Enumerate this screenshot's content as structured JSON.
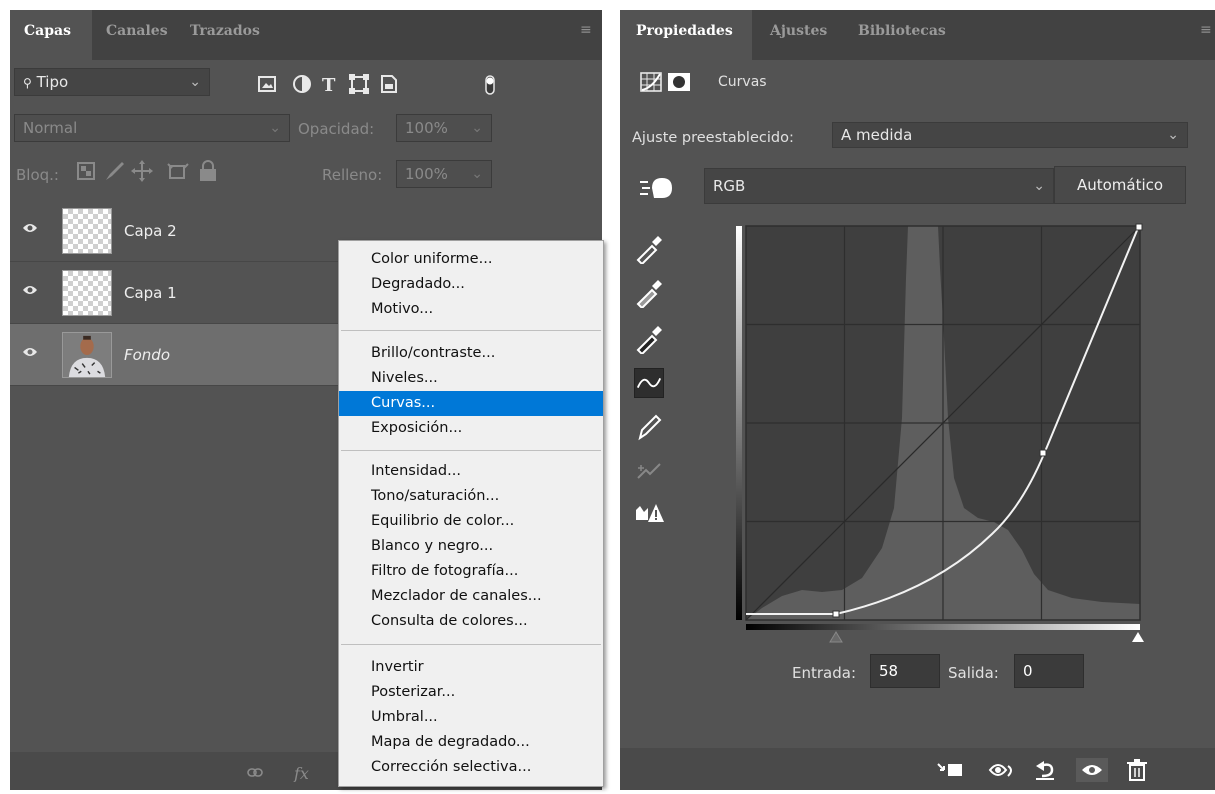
{
  "layers_panel": {
    "tabs": [
      {
        "label": "Capas",
        "active": true
      },
      {
        "label": "Canales",
        "active": false
      },
      {
        "label": "Trazados",
        "active": false
      }
    ],
    "filter": {
      "label": "Tipo",
      "icon": "search-icon"
    },
    "blend_mode": "Normal",
    "opacity": {
      "label": "Opacidad:",
      "value": "100%"
    },
    "lock_label": "Bloq.:",
    "fill": {
      "label": "Relleno:",
      "value": "100%"
    },
    "layers": [
      {
        "name": "Capa 2",
        "visible": true,
        "selected": false
      },
      {
        "name": "Capa 1",
        "visible": true,
        "selected": false
      },
      {
        "name": "Fondo",
        "visible": true,
        "selected": true
      }
    ]
  },
  "context_menu": {
    "groups": [
      [
        "Color uniforme...",
        "Degradado...",
        "Motivo..."
      ],
      [
        "Brillo/contraste...",
        "Niveles...",
        "Curvas...",
        "Exposición..."
      ],
      [
        "Intensidad...",
        "Tono/saturación...",
        "Equilibrio de color...",
        "Blanco y negro...",
        "Filtro de fotografía...",
        "Mezclador de canales...",
        "Consulta de colores..."
      ],
      [
        "Invertir",
        "Posterizar...",
        "Umbral...",
        "Mapa de degradado...",
        "Corrección selectiva..."
      ]
    ],
    "highlighted": "Curvas..."
  },
  "properties_panel": {
    "tabs": [
      {
        "label": "Propiedades",
        "active": true
      },
      {
        "label": "Ajustes",
        "active": false
      },
      {
        "label": "Bibliotecas",
        "active": false
      }
    ],
    "header_title": "Curvas",
    "preset": {
      "label": "Ajuste preestablecido:",
      "value": "A medida"
    },
    "channel": "RGB",
    "auto_button": "Automático",
    "input": {
      "label": "Entrada:",
      "value": "58"
    },
    "output": {
      "label": "Salida:",
      "value": "0"
    },
    "accent_color": "#0078d7"
  }
}
